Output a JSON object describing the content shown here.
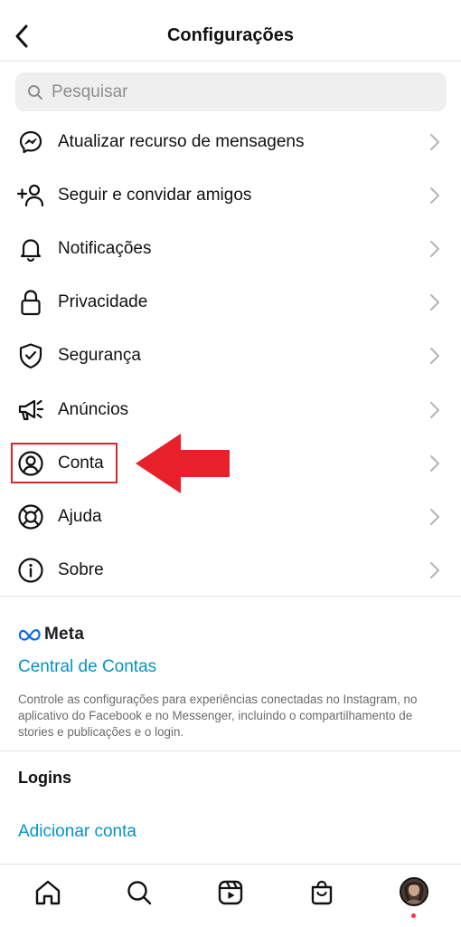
{
  "header": {
    "title": "Configurações"
  },
  "search": {
    "placeholder": "Pesquisar",
    "value": ""
  },
  "menu": {
    "items": [
      {
        "label": "Atualizar recurso de mensagens",
        "icon": "messenger-icon"
      },
      {
        "label": "Seguir e convidar amigos",
        "icon": "add-person-icon"
      },
      {
        "label": "Notificações",
        "icon": "bell-icon"
      },
      {
        "label": "Privacidade",
        "icon": "lock-icon"
      },
      {
        "label": "Segurança",
        "icon": "shield-check-icon"
      },
      {
        "label": "Anúncios",
        "icon": "megaphone-icon"
      },
      {
        "label": "Conta",
        "icon": "account-circle-icon"
      },
      {
        "label": "Ajuda",
        "icon": "lifebuoy-icon"
      },
      {
        "label": "Sobre",
        "icon": "info-icon"
      }
    ]
  },
  "annotation": {
    "highlighted_item": "Conta",
    "arrow_color": "#e8202a"
  },
  "meta_section": {
    "logo_text": "Meta",
    "accounts_center_link": "Central de Contas",
    "description": "Controle as configurações para experiências conectadas no Instagram, no aplicativo do Facebook e no Messenger, incluindo o compartilhamento de stories e publicações e o login."
  },
  "logins": {
    "heading": "Logins",
    "add_account_link": "Adicionar conta"
  },
  "tabbar": {
    "tabs": [
      "home-icon",
      "search-icon",
      "reels-icon",
      "shop-icon",
      "profile-avatar"
    ]
  },
  "colors": {
    "link": "#0095c6",
    "text": "#111111",
    "muted": "#6b6b6b",
    "divider": "#e4e4e4",
    "search_bg": "#efefef",
    "highlight": "#d9252a"
  }
}
